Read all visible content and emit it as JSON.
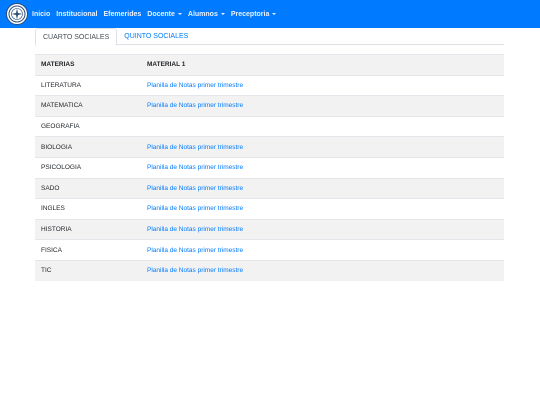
{
  "navbar": {
    "logo_icon": "school-seal-icon",
    "items": [
      {
        "label": "Inicio",
        "dropdown": false
      },
      {
        "label": "Institucional",
        "dropdown": false
      },
      {
        "label": "Efemerides",
        "dropdown": false
      },
      {
        "label": "Docente",
        "dropdown": true
      },
      {
        "label": "Alumnos",
        "dropdown": true
      },
      {
        "label": "Preceptoria",
        "dropdown": true
      }
    ],
    "colors": {
      "background": "#007bff"
    }
  },
  "tabs": [
    {
      "label": "CUARTO SOCIALES",
      "active": true
    },
    {
      "label": "QUINTO SOCIALES",
      "active": false
    }
  ],
  "table": {
    "headers": [
      "MATERIAS",
      "MATERIAL 1"
    ],
    "rows": [
      {
        "materia": "LITERATURA",
        "material": "Planilla de Notas primer trimestre"
      },
      {
        "materia": "MATEMATICA",
        "material": "Planilla de Notas primer trimestre"
      },
      {
        "materia": "GEOGRAFIA",
        "material": ""
      },
      {
        "materia": "BIOLOGIA",
        "material": "Planilla de Notas primer trimestre"
      },
      {
        "materia": "PSICOLOGIA",
        "material": "Planilla de Notas primer trimestre"
      },
      {
        "materia": "SADO",
        "material": "Planilla de Notas primer trimestre"
      },
      {
        "materia": "INGLES",
        "material": "Planilla de Notas primer trimestre"
      },
      {
        "materia": "HISTORIA",
        "material": "Planilla de Notas primer trimestre"
      },
      {
        "materia": "FISICA",
        "material": "Planilla de Notas primer trimestre"
      },
      {
        "materia": "TIC",
        "material": "Planilla de Notas primer trimestre"
      }
    ]
  }
}
